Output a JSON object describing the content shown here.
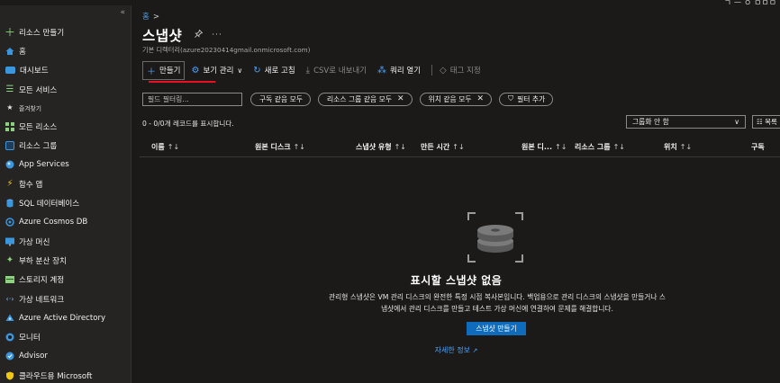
{
  "top_right_text": "ㄱ ㅡ ㅇ ㅁㅁㅁ",
  "sidebar": {
    "collapse_glyph": "«",
    "items": [
      {
        "label": "리소스 만들기",
        "icon": "plus-icon"
      },
      {
        "label": "홈",
        "icon": "home-icon"
      },
      {
        "label": "대시보드",
        "icon": "dashboard-icon"
      },
      {
        "label": "모든 서비스",
        "icon": "list-icon"
      },
      {
        "label": "즐겨찾기",
        "icon": "star-icon",
        "section": true
      },
      {
        "label": "모든 리소스",
        "icon": "grid-icon"
      },
      {
        "label": "리소스 그룹",
        "icon": "resource-group-icon"
      },
      {
        "label": "App Services",
        "icon": "app-services-icon"
      },
      {
        "label": "함수 앱",
        "icon": "function-app-icon"
      },
      {
        "label": "SQL 데이터베이스",
        "icon": "sql-database-icon"
      },
      {
        "label": "Azure Cosmos DB",
        "icon": "cosmos-db-icon"
      },
      {
        "label": "가상 머신",
        "icon": "virtual-machine-icon"
      },
      {
        "label": "부하 분산 장치",
        "icon": "load-balancer-icon"
      },
      {
        "label": "스토리지 계정",
        "icon": "storage-account-icon"
      },
      {
        "label": "가상 네트워크",
        "icon": "virtual-network-icon"
      },
      {
        "label": "Azure Active Directory",
        "icon": "active-directory-icon"
      },
      {
        "label": "모니터",
        "icon": "monitor-icon"
      },
      {
        "label": "Advisor",
        "icon": "advisor-icon"
      },
      {
        "label": "클라우드용 Microsoft",
        "icon": "defender-icon"
      }
    ]
  },
  "breadcrumb": {
    "home": "홈",
    "sep": ">"
  },
  "page": {
    "title": "스냅샷",
    "subtitle": "기본 디렉터리(azure20230414gmail.onmicrosoft.com)"
  },
  "toolbar": {
    "create": "만들기",
    "manage_view": "보기 관리",
    "refresh": "새로 고침",
    "export_csv": "CSV로 내보내기",
    "open_query": "쿼리 열기",
    "assign_tags": "태그 지정"
  },
  "filters": {
    "placeholder": "필드 필터링...",
    "subscription": "구독 같음 모두",
    "resource_group": "리소스 그룹 같음 모두",
    "location": "위치 같음 모두",
    "add_filter": "필터 추가"
  },
  "records": "0 - 0/0개 레코드를 표시합니다.",
  "grouping": {
    "value": "그룹화 안 함"
  },
  "list_view": "☷ 목록",
  "columns": [
    {
      "label": "이름",
      "sort": "↑↓"
    },
    {
      "label": "원본 디스크",
      "sort": "↑↓"
    },
    {
      "label": "스냅샷 유형",
      "sort": "↑↓"
    },
    {
      "label": "만든 시간",
      "sort": "↑↓"
    },
    {
      "label": "원본 디...",
      "sort": "↑↓"
    },
    {
      "label": "리소스 그룹",
      "sort": "↑↓"
    },
    {
      "label": "위치",
      "sort": "↑↓"
    },
    {
      "label": "구독",
      "sort": ""
    }
  ],
  "empty_state": {
    "title": "표시할 스냅샷 없음",
    "description_line1": "관리형 스냅샷은 VM 관리 디스크의 완전한 특정 시점 복사본입니다. 백업용으로 관리 디스크의 스냅샷을 만들거나 스",
    "description_line2": "냅샷에서 관리 디스크를 만들고 테스트 가상 머신에 연결하여 문제를 해결합니다.",
    "cta": "스냅샷 만들기",
    "learn_more": "자세한 정보"
  },
  "colors": {
    "accent": "#4fa3f7",
    "primary_button": "#0f6cbd",
    "underline": "#e81123"
  }
}
